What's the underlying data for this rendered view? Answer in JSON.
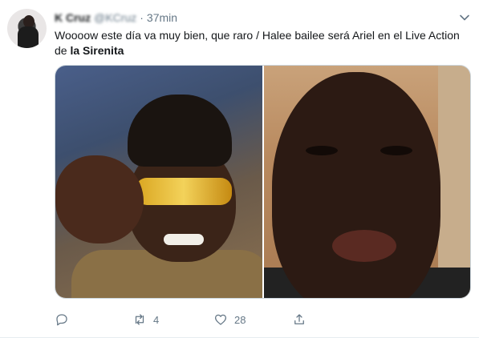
{
  "tweet": {
    "display_name": "K Cruz",
    "handle": "@KCruz",
    "separator": "·",
    "time": "37min",
    "text_plain": "Woooow este día va muy bien, que raro / Halee bailee será Ariel en el Live Action de ",
    "text_bold": "la Sirenita",
    "media": {
      "left_photo": "laughing-man-golden-glasses",
      "right_photo": "crying-man"
    },
    "actions": {
      "reply_icon": "reply-icon",
      "retweet_icon": "retweet-icon",
      "retweet_count": "4",
      "like_icon": "heart-icon",
      "like_count": "28",
      "share_icon": "share-icon"
    },
    "more_icon": "chevron-down-icon"
  },
  "colors": {
    "text": "#14171a",
    "secondary": "#657786",
    "border": "#ccd6dd",
    "background": "#ffffff"
  }
}
